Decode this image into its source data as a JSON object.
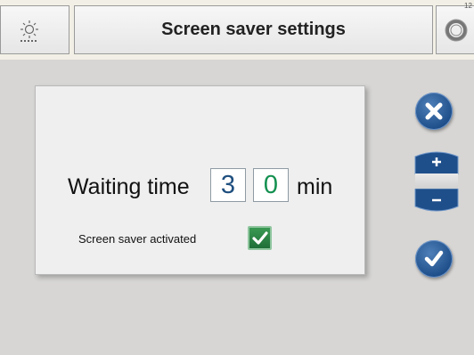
{
  "header": {
    "title": "Screen saver settings",
    "corner_number": "12",
    "icons": [
      "brightness-icon",
      "settings-ring-icon"
    ]
  },
  "panel": {
    "waiting_label": "Waiting time",
    "hours_value": "3",
    "minutes_value": "0",
    "unit": "min",
    "activated_label": "Screen saver activated",
    "activated_checked": true
  },
  "buttons": {
    "icons": [
      "close-icon",
      "plus-icon",
      "minus-icon",
      "checkmark-icon"
    ]
  },
  "colors": {
    "button_blue": "#1f4f8a",
    "checkbox_green": "#2a8045",
    "hours_text": "#1f4f7f",
    "minutes_text": "#149050"
  }
}
